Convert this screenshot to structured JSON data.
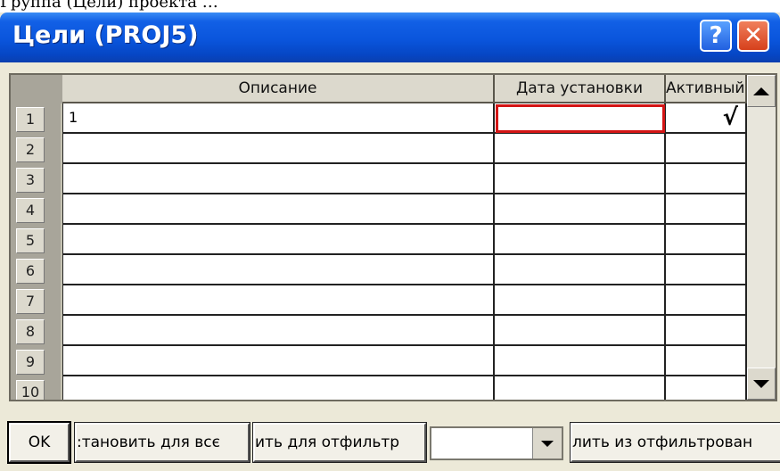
{
  "top_strip_text": "Группа  (Цели)  проекта  …",
  "window": {
    "title": "Цели (PROJ5)",
    "help_glyph": "?",
    "close_glyph": "✕"
  },
  "table": {
    "columns": [
      "Описание",
      "Дата установки",
      "Активный"
    ],
    "rows": [
      {
        "num": "1",
        "desc": "1",
        "date": "",
        "active": "√"
      },
      {
        "num": "2",
        "desc": "",
        "date": "",
        "active": ""
      },
      {
        "num": "3",
        "desc": "",
        "date": "",
        "active": ""
      },
      {
        "num": "4",
        "desc": "",
        "date": "",
        "active": ""
      },
      {
        "num": "5",
        "desc": "",
        "date": "",
        "active": ""
      },
      {
        "num": "6",
        "desc": "",
        "date": "",
        "active": ""
      },
      {
        "num": "7",
        "desc": "",
        "date": "",
        "active": ""
      },
      {
        "num": "8",
        "desc": "",
        "date": "",
        "active": ""
      },
      {
        "num": "9",
        "desc": "",
        "date": "",
        "active": ""
      },
      {
        "num": "10",
        "desc": "",
        "date": "",
        "active": ""
      }
    ]
  },
  "buttons": {
    "ok": "OK",
    "set_for_all": ":тановить для всє",
    "for_filtered": "ить для отфильтр",
    "delete_filtered": "лить из отфильтрован"
  },
  "combo": {
    "value": ""
  },
  "colors": {
    "titlebar": "#0a55dc",
    "active_cell_border": "#d41515",
    "window_bg": "#ece9d8"
  }
}
